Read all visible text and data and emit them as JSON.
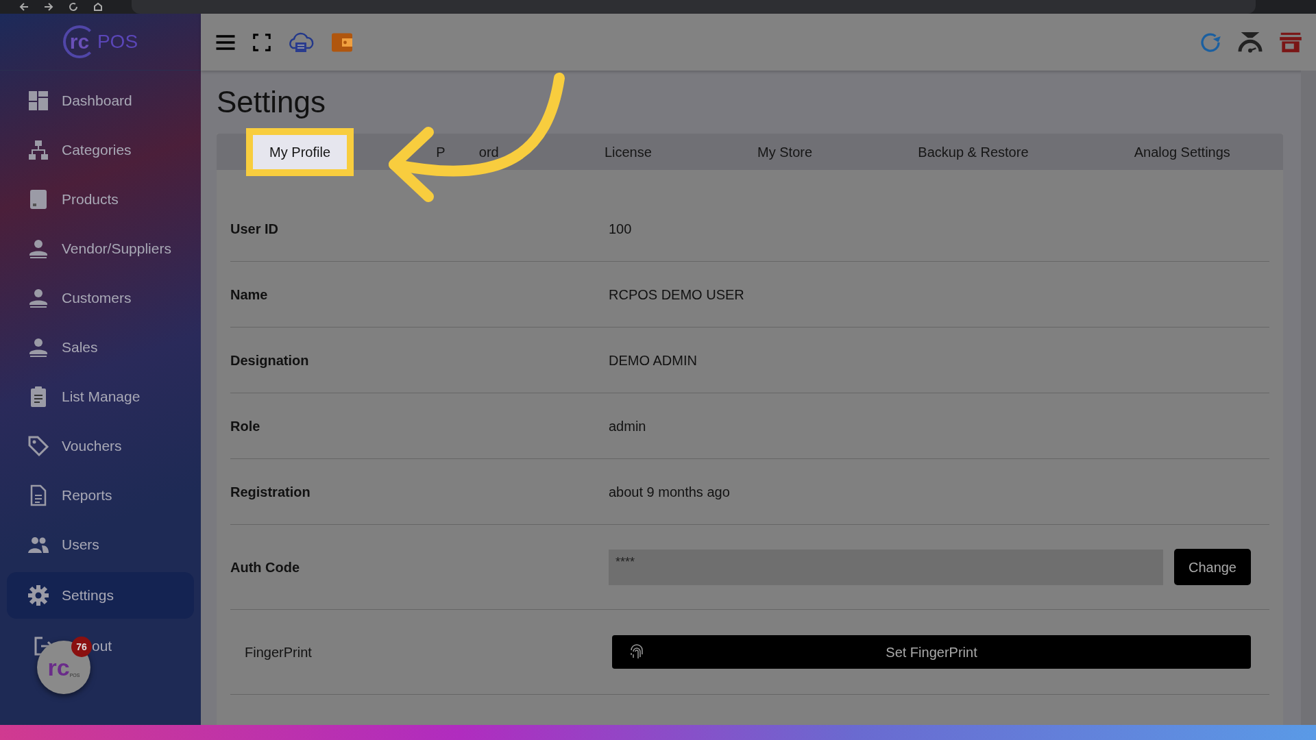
{
  "sidebar": {
    "logo": {
      "mark": "rc",
      "text": "POS"
    },
    "items": [
      {
        "label": "Dashboard",
        "selected": false
      },
      {
        "label": "Categories",
        "selected": false
      },
      {
        "label": "Products",
        "selected": false
      },
      {
        "label": "Vendor/Suppliers",
        "selected": false
      },
      {
        "label": "Customers",
        "selected": false
      },
      {
        "label": "Sales",
        "selected": false
      },
      {
        "label": "List Manage",
        "selected": false
      },
      {
        "label": "Vouchers",
        "selected": false
      },
      {
        "label": "Reports",
        "selected": false
      },
      {
        "label": "Users",
        "selected": false
      },
      {
        "label": "Settings",
        "selected": true
      },
      {
        "label": "out",
        "selected": false
      }
    ]
  },
  "page_title": "Settings",
  "tabs": [
    {
      "label": "My Profile",
      "selected": true,
      "highlighted": true
    },
    {
      "label_parts": [
        "P",
        "ord"
      ],
      "selected": false,
      "highlighted": false
    },
    {
      "label": "License",
      "selected": false,
      "highlighted": false
    },
    {
      "label": "My Store",
      "selected": false,
      "highlighted": false
    },
    {
      "label": "Backup & Restore",
      "selected": false,
      "highlighted": false
    },
    {
      "label": "Analog Settings",
      "selected": false,
      "highlighted": false
    }
  ],
  "profile": [
    {
      "kind": "text",
      "label": "User ID",
      "value": "100"
    },
    {
      "kind": "text",
      "label": "Name",
      "value": "RCPOS DEMO USER"
    },
    {
      "kind": "text",
      "label": "Designation",
      "value": "DEMO ADMIN"
    },
    {
      "kind": "text",
      "label": "Role",
      "value": "admin"
    },
    {
      "kind": "text",
      "label": "Registration",
      "value": "about 9 months ago"
    },
    {
      "kind": "field",
      "label": "Auth Code",
      "value": "****",
      "button": "Change"
    },
    {
      "kind": "action",
      "label": "FingerPrint",
      "button": "Set FingerPrint"
    }
  ],
  "chat_bubble": {
    "mark": "rc",
    "sub": "POS",
    "badge": "76"
  }
}
